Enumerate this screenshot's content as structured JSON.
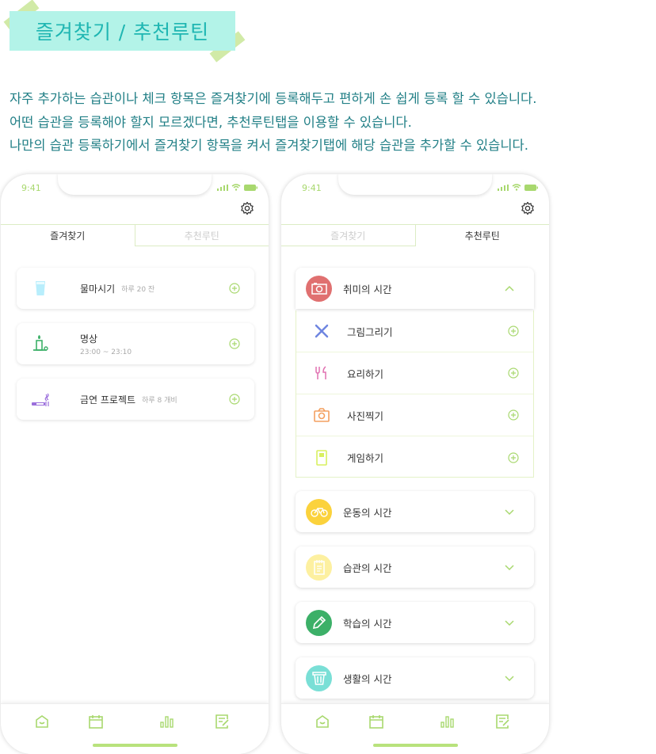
{
  "header": {
    "title": "즐겨찾기 / 추천루틴"
  },
  "description": [
    "자주 추가하는 습관이나 체크 항목은 즐겨찾기에 등록해두고 편하게 손 쉽게 등록 할 수 있습니다.",
    "어떤 습관을 등록해야 할지 모르겠다면, 추천루틴탭을 이용할 수 있습니다.",
    "나만의 습관 등록하기에서 즐겨찾기 항목을 켜서 즐겨찾기탭에 해당 습관을 추가할 수 있습니다."
  ],
  "status": {
    "time": "9:41"
  },
  "tabs": {
    "favorites": "즐겨찾기",
    "recommended": "추천루틴"
  },
  "favorites": [
    {
      "label": "물마시기",
      "detail": "하루 20 잔",
      "icon": "water-glass-icon"
    },
    {
      "label": "명상",
      "detail": "23:00 ~ 23:10",
      "icon": "candle-icon"
    },
    {
      "label": "금연 프로젝트",
      "detail": "하루 8 개비",
      "icon": "cigarette-icon"
    }
  ],
  "routines": {
    "expanded": {
      "label": "취미의 시간",
      "color": "#e07070",
      "items": [
        "그림그리기",
        "요리하기",
        "사진찍기",
        "게임하기"
      ]
    },
    "collapsed": [
      {
        "label": "운동의 시간",
        "color": "#fbd23c"
      },
      {
        "label": "습관의 시간",
        "color": "#fdf0a0"
      },
      {
        "label": "학습의 시간",
        "color": "#3cb068"
      },
      {
        "label": "생활의 시간",
        "color": "#7adfd6"
      }
    ]
  },
  "colors": {
    "accent": "#a8d86e",
    "title_bg": "#b3f3e8",
    "title_text": "#1fb6b2"
  }
}
